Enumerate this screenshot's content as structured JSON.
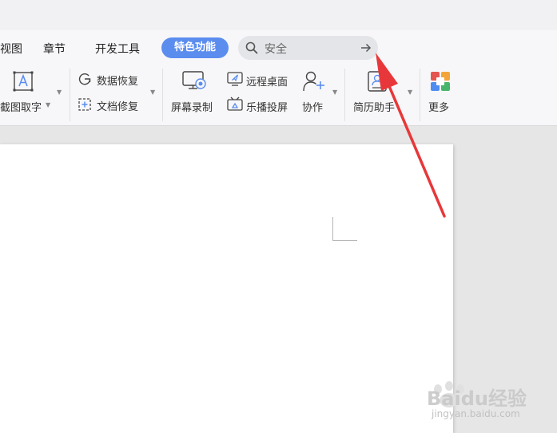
{
  "menu": {
    "view": "视图",
    "chapter": "章节",
    "dev_tools": "开发工具",
    "special": "特色功能"
  },
  "search": {
    "query": "安全",
    "icon": "search-icon",
    "go_icon": "arrow-right-icon"
  },
  "ribbon": {
    "screenshot_ocr": "截图取字",
    "data_recovery": "数据恢复",
    "doc_repair": "文档修复",
    "screen_record": "屏幕录制",
    "remote_desktop": "远程桌面",
    "cast_screen": "乐播投屏",
    "collaborate": "协作",
    "resume_helper": "简历助手",
    "more": "更多"
  },
  "colors": {
    "accent": "#5b8def",
    "annotation_arrow": "#e8373a"
  },
  "watermark": {
    "brand": "Baidu经验",
    "url": "jingyan.baidu.com"
  }
}
